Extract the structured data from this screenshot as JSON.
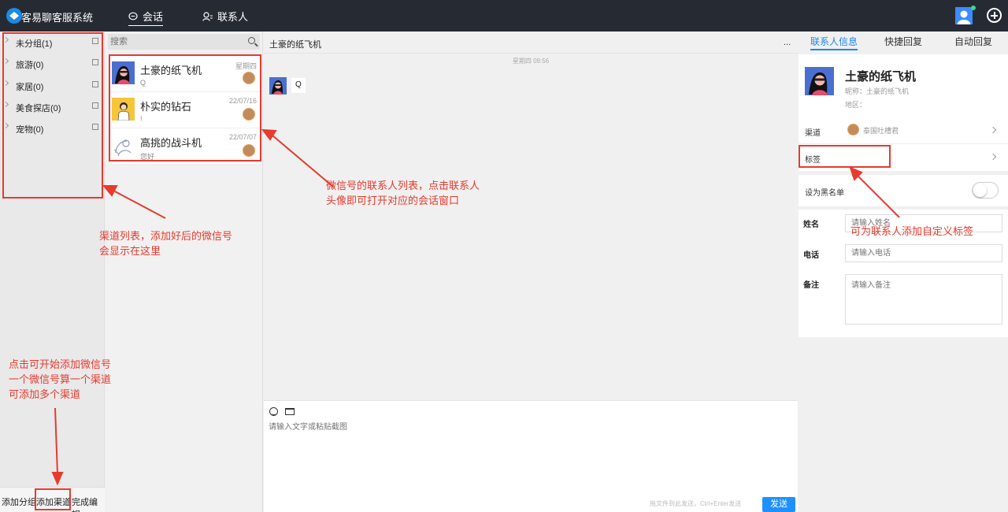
{
  "topbar": {
    "app_title": "客易聊客服系统",
    "nav": [
      {
        "label": "会话",
        "icon": "chat-bubble-icon",
        "active": true
      },
      {
        "label": "联系人",
        "icon": "contacts-icon",
        "active": false
      }
    ]
  },
  "groups": {
    "items": [
      {
        "label": "未分组(1)"
      },
      {
        "label": "旅游(0)"
      },
      {
        "label": "家居(0)"
      },
      {
        "label": "美食探店(0)"
      },
      {
        "label": "宠物(0)"
      }
    ],
    "footer": {
      "add_group": "添加分组",
      "add_channel": "添加渠道",
      "finish_edit": "完成编辑"
    }
  },
  "contacts": {
    "search_placeholder": "搜索",
    "list": [
      {
        "name": "土豪的纸飞机",
        "last_msg": "Q",
        "date": "星期四"
      },
      {
        "name": "朴实的钻石",
        "last_msg": "!",
        "date": "22/07/16"
      },
      {
        "name": "高挑的战斗机",
        "last_msg": "您好",
        "date": "22/07/07"
      }
    ]
  },
  "chat": {
    "title": "土豪的纸飞机",
    "more": "...",
    "time_separator": "星期四 09:56",
    "message": "Q",
    "input_placeholder": "请输入文字或粘贴截图",
    "send_hint": "拖文件到此发送，Ctrl+Enter发送",
    "send_label": "发送"
  },
  "right_panel": {
    "tabs": [
      "联系人信息",
      "快捷回复",
      "自动回复"
    ],
    "contact": {
      "name": "土豪的纸飞机",
      "nickname": "昵称：土豪的纸飞机",
      "region": "地区："
    },
    "channel_label": "渠道",
    "channel_name": "泰国吐槽君",
    "tag_label": "标签",
    "blacklist_label": "设为黑名单",
    "form": {
      "name_label": "姓名",
      "name_placeholder": "请输入姓名",
      "phone_label": "电话",
      "phone_placeholder": "请输入电话",
      "note_label": "备注",
      "note_placeholder": "请输入备注"
    }
  },
  "annotations": {
    "channel_list": "渠道列表，添加好后的微信号\n会显示在这里",
    "contact_list": "微信号的联系人列表，点击联系人\n头像即可打开对应的会话窗口",
    "add_channel": "点击可开始添加微信号\n一个微信号算一个渠道\n可添加多个渠道",
    "tags": "可为联系人添加自定义标签"
  },
  "colors": {
    "topbar_bg": "#262b33",
    "accent": "#1e88e5",
    "annotation_red": "#e63b2e",
    "send_button": "#1e90ff"
  }
}
